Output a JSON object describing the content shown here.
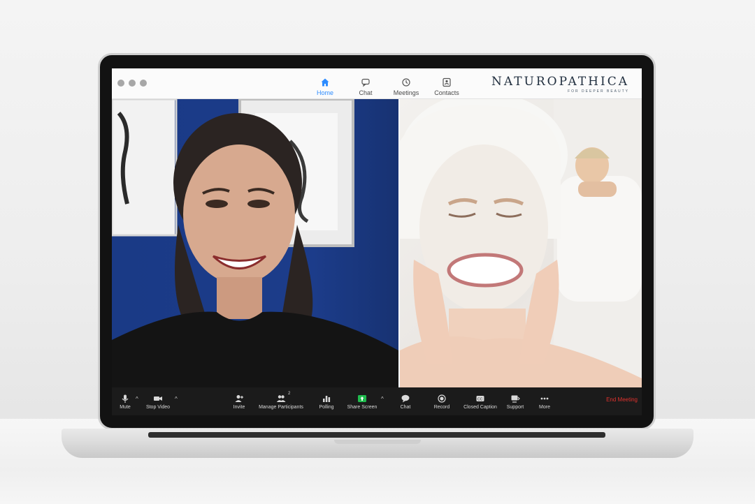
{
  "window": {
    "traffic_lights": [
      "dot",
      "dot",
      "dot"
    ]
  },
  "tabs": [
    {
      "label": "Home",
      "icon": "home-icon",
      "active": true
    },
    {
      "label": "Chat",
      "icon": "chat-bubble-icon",
      "active": false
    },
    {
      "label": "Meetings",
      "icon": "clock-icon",
      "active": false
    },
    {
      "label": "Contacts",
      "icon": "contact-card-icon",
      "active": false
    }
  ],
  "brand": {
    "name": "NATUROPATHICA",
    "tagline": "FOR DEEPER BEAUTY"
  },
  "videos": {
    "left": {
      "description": "woman smiling in office with blue wall"
    },
    "right": {
      "description": "woman with face mask and towel, child in background"
    }
  },
  "toolbar": {
    "mute": "Mute",
    "stop_video": "Stop Video",
    "invite": "Invite",
    "manage_participants": "Manage Participants",
    "participant_count": "2",
    "polling": "Polling",
    "share_screen": "Share Screen",
    "chat": "Chat",
    "record": "Record",
    "closed_caption": "Closed Caption",
    "support": "Support",
    "more": "More",
    "end_meeting": "End Meeting"
  },
  "colors": {
    "accent": "#2d8cff",
    "share_green": "#1fbb4d",
    "end_red": "#e0322e",
    "toolbar_bg": "#1b1b1b"
  }
}
